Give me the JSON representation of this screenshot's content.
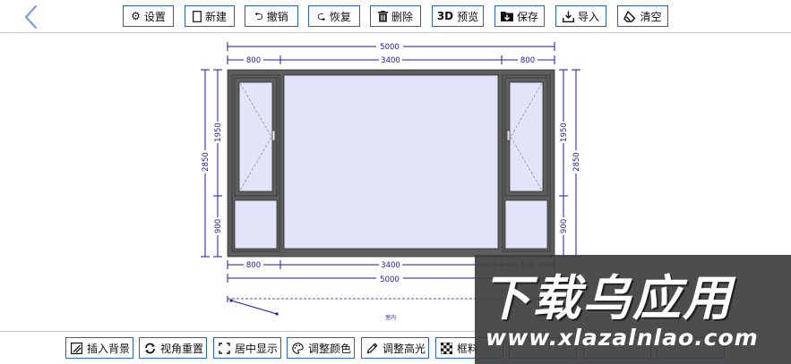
{
  "top_toolbar": {
    "back_icon": "chevron-left-icon",
    "buttons": [
      {
        "label": "设置",
        "icon": "gear-icon"
      },
      {
        "label": "新建",
        "icon": "new-page-icon"
      },
      {
        "label": "撤销",
        "icon": "undo-icon"
      },
      {
        "label": "恢复",
        "icon": "redo-icon"
      },
      {
        "label": "删除",
        "icon": "trash-icon"
      },
      {
        "label": "预览",
        "icon": "3d-icon",
        "icon_text": "3D"
      },
      {
        "label": "保存",
        "icon": "save-folder-icon"
      },
      {
        "label": "导入",
        "icon": "import-icon"
      },
      {
        "label": "清空",
        "icon": "eraser-icon"
      }
    ]
  },
  "drawing": {
    "dims_top": {
      "total": "5000",
      "segments": [
        "800",
        "3400",
        "800"
      ]
    },
    "dims_bottom": {
      "total": "5000",
      "segments": [
        "800",
        "3400",
        "800"
      ]
    },
    "dims_left": {
      "total": "2850",
      "segments": [
        "1950",
        "900"
      ]
    },
    "dims_right": {
      "total": "2850",
      "segments": [
        "1950",
        "900"
      ]
    },
    "room_label": "室内"
  },
  "bottom_toolbar": {
    "buttons": [
      {
        "label": "插入背景",
        "icon": "image-icon"
      },
      {
        "label": "视角重置",
        "icon": "rotate-icon"
      },
      {
        "label": "居中显示",
        "icon": "center-icon"
      },
      {
        "label": "调整颜色",
        "icon": "palette-icon"
      },
      {
        "label": "调整高光",
        "icon": "pen-icon"
      },
      {
        "label": "框料",
        "icon": "checker-icon"
      }
    ]
  },
  "watermark": {
    "title": "下载乌应用",
    "url": "www.xlazalnlao.com"
  },
  "colors": {
    "accent": "#2b62c8",
    "dimension_line": "#1a1aa8",
    "frame": "#5d5d5d",
    "glass": "#e2e5fa"
  }
}
